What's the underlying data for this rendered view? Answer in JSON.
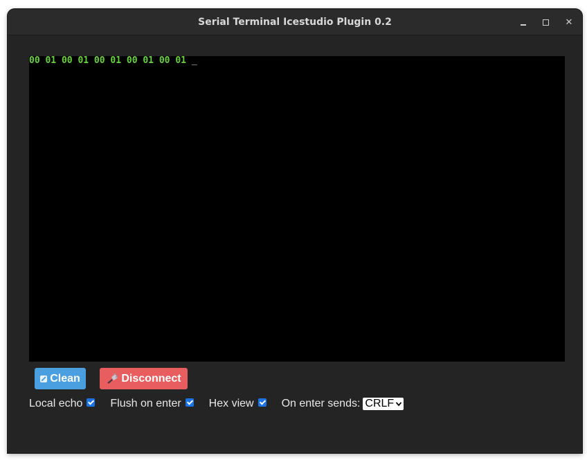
{
  "window": {
    "title": "Serial Terminal Icestudio Plugin 0.2",
    "controls": {
      "minimize": "minimize-icon",
      "maximize": "maximize-icon",
      "close": "close-icon"
    }
  },
  "terminal": {
    "output": "00 01 00 01 00 01 00 01 00 01 ",
    "cursor": "_",
    "text_color": "#67d43a",
    "background": "#000000"
  },
  "buttons": {
    "clean": {
      "label": "Clean",
      "icon": "eraser-icon",
      "color": "#4a9fe0"
    },
    "disconnect": {
      "label": "Disconnect",
      "icon": "plug-icon",
      "color": "#e85d5d"
    }
  },
  "options": {
    "local_echo": {
      "label": "Local echo",
      "checked": true
    },
    "flush_on_enter": {
      "label": "Flush on enter",
      "checked": true
    },
    "hex_view": {
      "label": "Hex view",
      "checked": true
    },
    "on_enter_sends": {
      "label": "On enter sends:",
      "selected": "CRLF"
    }
  },
  "colors": {
    "accent": "#1a73e8",
    "window_bg": "#242424"
  }
}
